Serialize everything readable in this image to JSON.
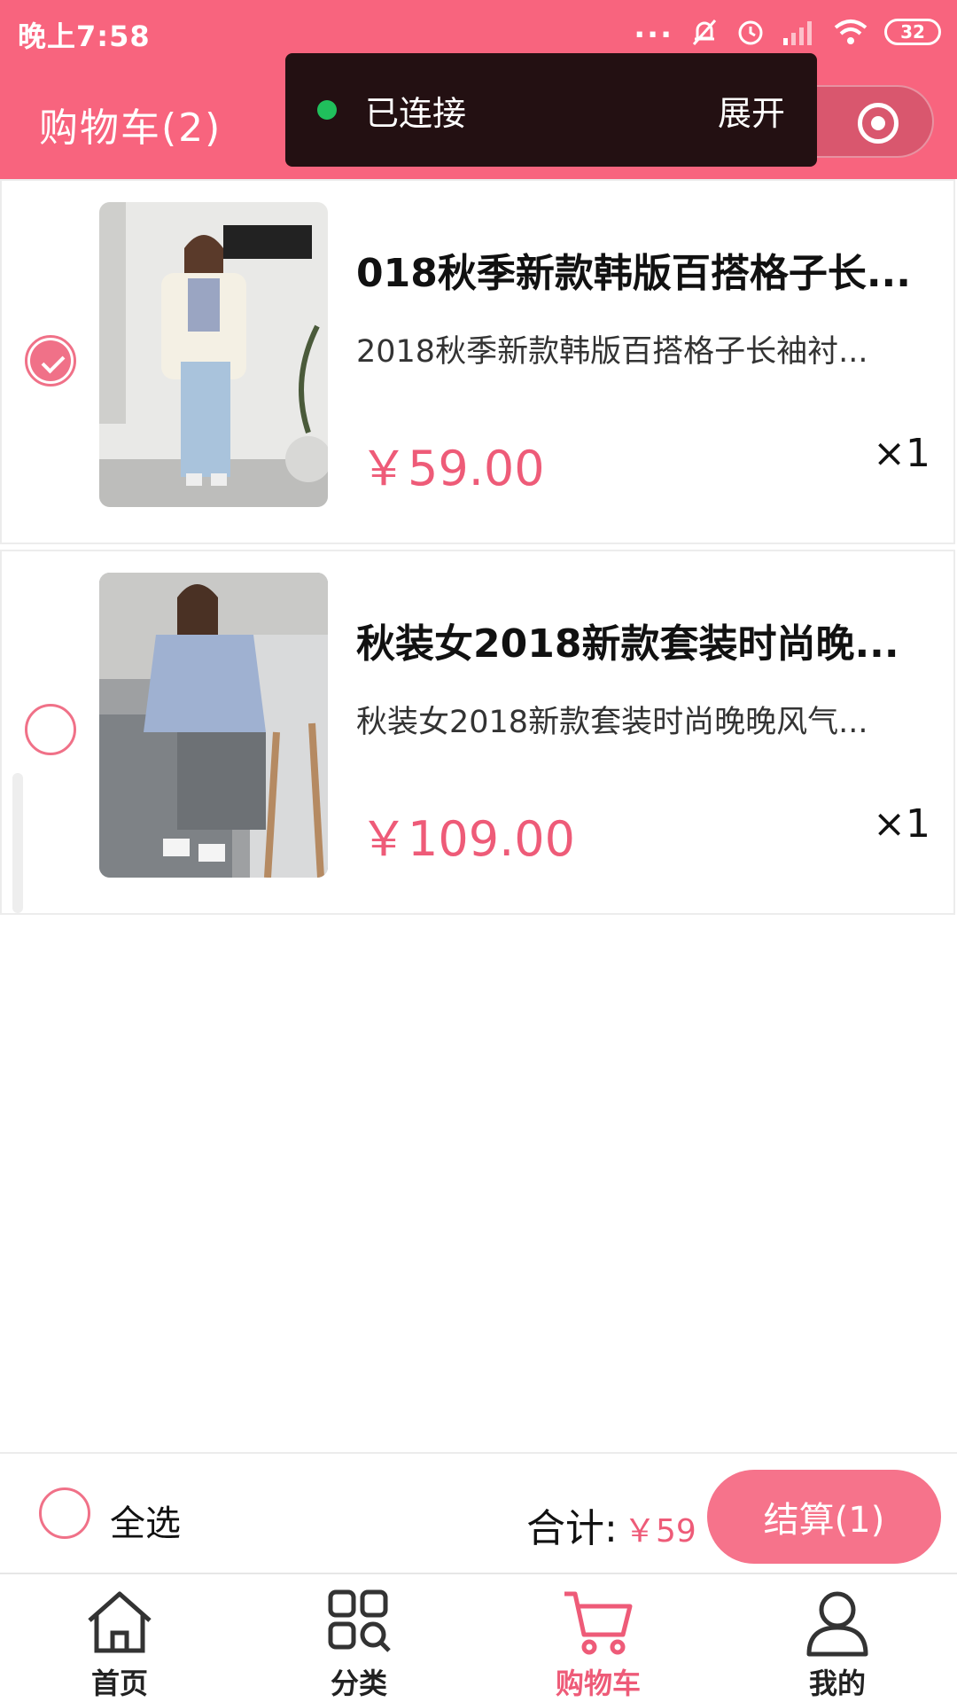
{
  "status_bar": {
    "time": "晚上7:58",
    "dots": "...",
    "battery": "32"
  },
  "nav": {
    "title": "购物车(2)"
  },
  "toast": {
    "status": "已连接",
    "expand": "展开"
  },
  "cart": {
    "items": [
      {
        "checked": true,
        "title": "018秋季新款韩版百搭格子长...",
        "desc": "2018秋季新款韩版百搭格子长袖衬...",
        "price": "￥59.00",
        "qty": "×1"
      },
      {
        "checked": false,
        "title": "秋装女2018新款套装时尚晚...",
        "desc": "秋装女2018新款套装时尚晚晚风气...",
        "price": "￥109.00",
        "qty": "×1"
      }
    ]
  },
  "footer": {
    "select_all": "全选",
    "total_label": "合计:",
    "total_value": "￥59",
    "checkout": "结算(1)"
  },
  "tabs": [
    {
      "label": "首页",
      "icon": "home-icon"
    },
    {
      "label": "分类",
      "icon": "category-icon"
    },
    {
      "label": "购物车",
      "icon": "cart-icon",
      "active": true
    },
    {
      "label": "我的",
      "icon": "user-icon"
    }
  ],
  "colors": {
    "brand": "#f8647e",
    "price": "#ee5b78",
    "checkout": "#f6738b",
    "connected_dot": "#20c05c"
  }
}
